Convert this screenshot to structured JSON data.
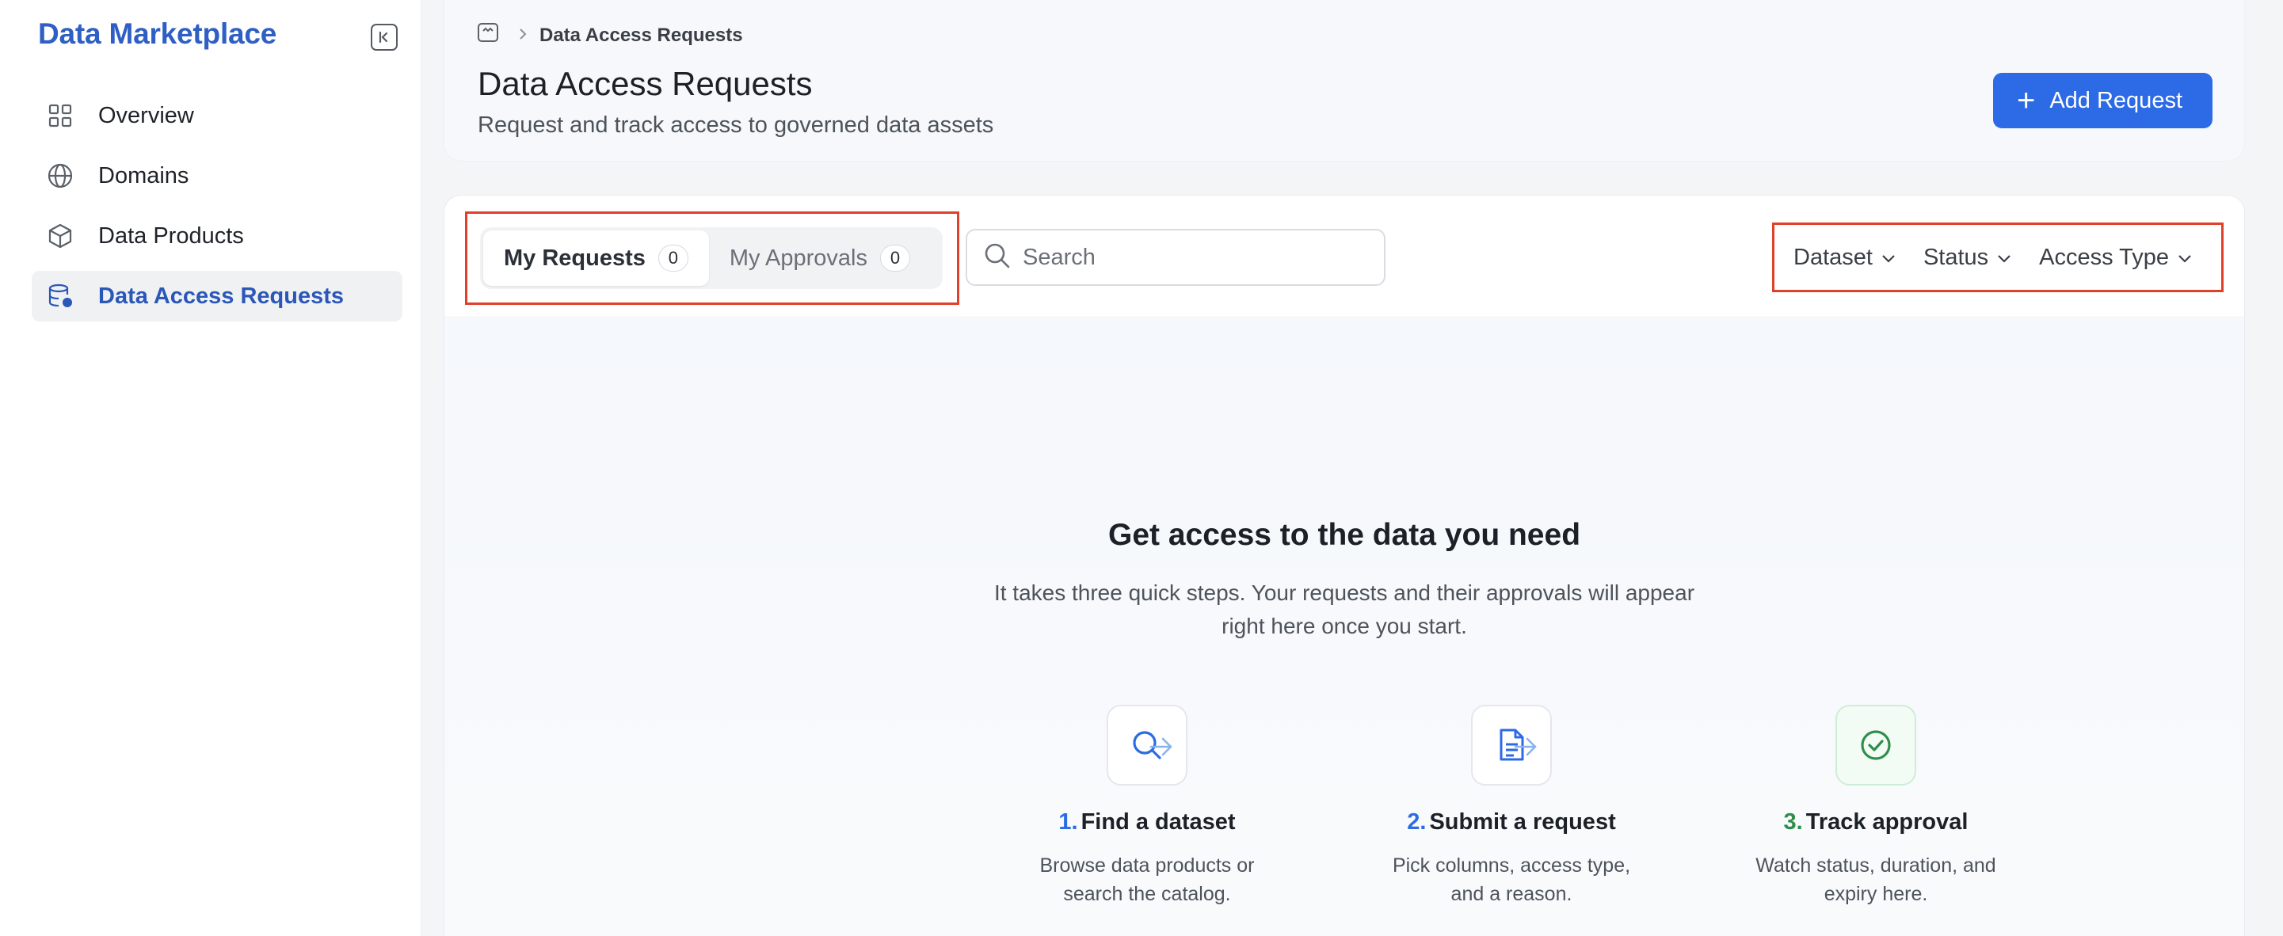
{
  "app": {
    "brand": "Data Marketplace"
  },
  "sidebar": {
    "items": [
      {
        "label": "Overview",
        "icon": "grid-icon"
      },
      {
        "label": "Domains",
        "icon": "globe-icon"
      },
      {
        "label": "Data Products",
        "icon": "cube-icon"
      },
      {
        "label": "Data Access Requests",
        "icon": "database-lock-icon",
        "active": true
      }
    ]
  },
  "header": {
    "breadcrumb": "Data Access Requests",
    "title": "Data Access Requests",
    "subtitle": "Request and track access to governed data assets",
    "add_button": "Add Request"
  },
  "toolbar": {
    "tabs": [
      {
        "label": "My Requests",
        "count": "0",
        "active": true
      },
      {
        "label": "My Approvals",
        "count": "0",
        "active": false
      }
    ],
    "search_placeholder": "Search",
    "filters": [
      "Dataset",
      "Status",
      "Access Type"
    ]
  },
  "empty_state": {
    "title": "Get access to the data you need",
    "description": "It takes three quick steps. Your requests and their approvals will appear right here once you start.",
    "steps": [
      {
        "number": "1.",
        "title": "Find a dataset",
        "desc_line1": "Browse data products or",
        "desc_line2": "search the catalog.",
        "icon": "search-icon"
      },
      {
        "number": "2.",
        "title": "Submit a request",
        "desc_line1": "Pick columns, access type,",
        "desc_line2": "and a reason.",
        "icon": "document-icon"
      },
      {
        "number": "3.",
        "title": "Track approval",
        "desc_line1": "Watch status, duration, and",
        "desc_line2": "expiry here.",
        "icon": "check-circle-icon"
      }
    ]
  },
  "colors": {
    "accent": "#2c6ae6",
    "brand": "#2f5fc4",
    "success": "#2f8f4a",
    "highlight": "#e0402a"
  }
}
